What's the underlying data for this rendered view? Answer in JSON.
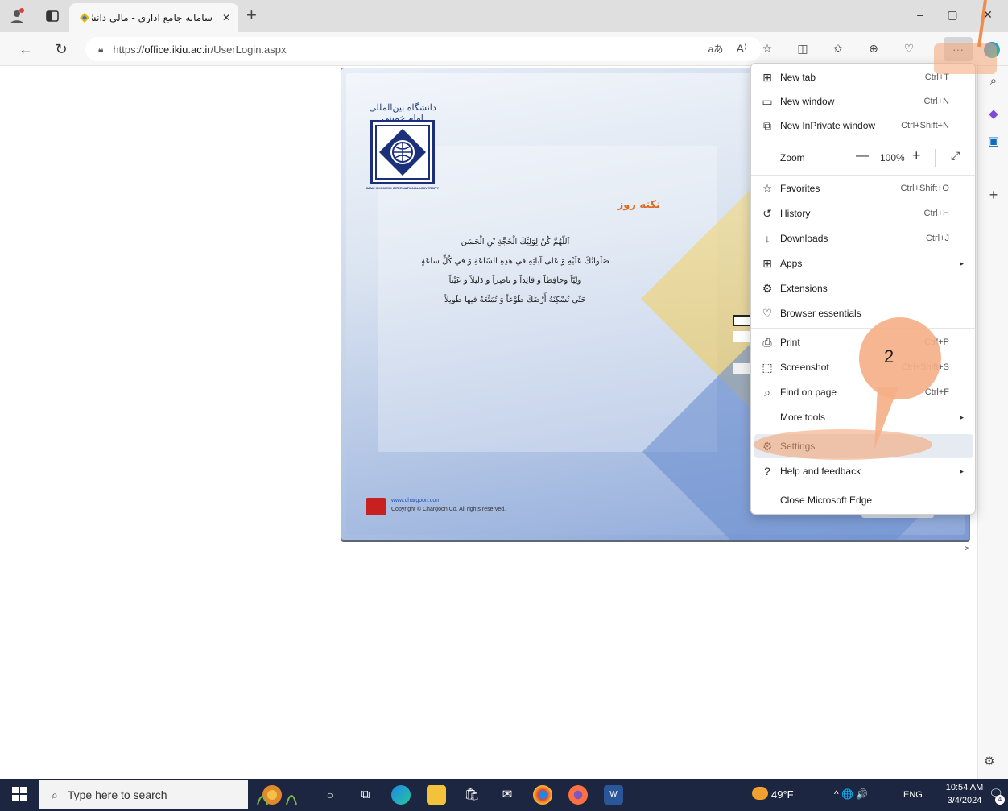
{
  "browser": {
    "tab": {
      "title": "سامانه جامع اداری - مالی دانشگاه",
      "close_symbol": "✕"
    },
    "new_tab_symbol": "+",
    "window_controls": {
      "minimize": "–",
      "restore": "▢",
      "close": "✕"
    },
    "address": {
      "url_prefix": "https://",
      "url_host": "office.ikiu.ac.ir",
      "url_path": "/UserLogin.aspx"
    },
    "toolbar_icons": [
      "read-aloud-icon",
      "immersive-reader-icon",
      "favorite-star-icon",
      "split-screen-icon",
      "favorites-icon",
      "collections-icon",
      "browser-essentials-icon"
    ],
    "more_symbol": "···"
  },
  "page": {
    "university_title": "ام خمینی(ره)",
    "calligraphy_text": "دانشگاه بین‌المللی امام خمینی",
    "logo_caption": "IMAM KHOMEINI INTERNATIONAL UNIVERSITY",
    "tip_title": "نکته روز",
    "prayer_lines": [
      "اَللّهُمَّ كُنْ لِوَلِيِّكَ الْحُجَّةِ بْنِ الْحَسَن",
      "صَلَواتُكَ عَلَيْهِ وَ عَلى آبائِهِ في هذِهِ السّاعَةِ وَ في كُلِّ ساعَةٍ",
      "وَلِيّاً وَحافِظاً وَ قائِداً وَ ناصِراً وَ دَليلاً وَ عَيْناً",
      "حَتّى تُسْكِنَهُ أَرْضَكَ طَوْعاً وَ تُمَتِّعَهُ فيها طَويلاً"
    ],
    "footer_link": "www.chargoon.com",
    "footer_copyright": "Copyright © Chargoon Co. All rights reserved.",
    "chevron": ">"
  },
  "menu": {
    "items": [
      {
        "key": "new-tab",
        "icon": "⊞",
        "label": "New tab",
        "shortcut": "Ctrl+T"
      },
      {
        "key": "new-window",
        "icon": "▭",
        "label": "New window",
        "shortcut": "Ctrl+N"
      },
      {
        "key": "new-inprivate",
        "icon": "⧉",
        "label": "New InPrivate window",
        "shortcut": "Ctrl+Shift+N"
      }
    ],
    "zoom": {
      "label": "Zoom",
      "minus": "—",
      "value": "100%",
      "plus": "+",
      "fullscreen": "⤢"
    },
    "items2": [
      {
        "key": "favorites",
        "icon": "☆",
        "label": "Favorites",
        "shortcut": "Ctrl+Shift+O"
      },
      {
        "key": "history",
        "icon": "↺",
        "label": "History",
        "shortcut": "Ctrl+H"
      },
      {
        "key": "downloads",
        "icon": "↓",
        "label": "Downloads",
        "shortcut": "Ctrl+J"
      },
      {
        "key": "apps",
        "icon": "⊞",
        "label": "Apps",
        "shortcut": "",
        "arrow": "▸"
      },
      {
        "key": "extensions",
        "icon": "⚙",
        "label": "Extensions",
        "shortcut": ""
      },
      {
        "key": "browser-essentials",
        "icon": "♡",
        "label": "Browser essentials",
        "shortcut": ""
      }
    ],
    "items3": [
      {
        "key": "print",
        "icon": "⎙",
        "label": "Print",
        "shortcut": "Ctrl+P"
      },
      {
        "key": "screenshot",
        "icon": "⬚",
        "label": "Screenshot",
        "shortcut": "Ctrl+Shift+S"
      },
      {
        "key": "find-on-page",
        "icon": "⌕",
        "label": "Find on page",
        "shortcut": "Ctrl+F"
      },
      {
        "key": "more-tools",
        "icon": "",
        "label": "More tools",
        "shortcut": "",
        "arrow": "▸"
      }
    ],
    "items4": [
      {
        "key": "settings",
        "icon": "⚙",
        "label": "Settings",
        "shortcut": ""
      },
      {
        "key": "help",
        "icon": "?",
        "label": "Help and feedback",
        "shortcut": "",
        "arrow": "▸"
      }
    ],
    "close_label": "Close Microsoft Edge"
  },
  "annotation": {
    "step_label": "2",
    "highlight_color": "#f4a578"
  },
  "taskbar": {
    "search_placeholder": "Type here to search",
    "weather": "49°F",
    "tray": "^ 🌐 🔊",
    "language": "ENG",
    "time": "10:54 AM",
    "date": "3/4/2024",
    "notification_count": "4"
  }
}
